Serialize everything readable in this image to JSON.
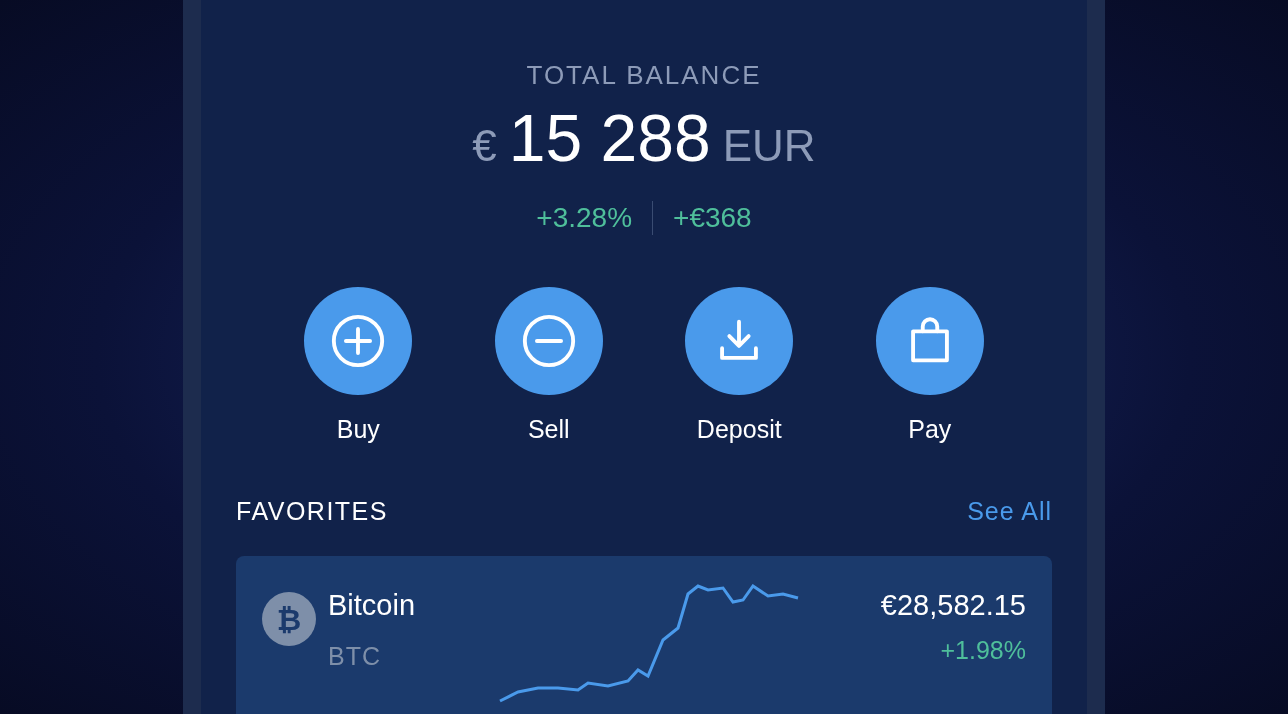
{
  "balance": {
    "label": "TOTAL BALANCE",
    "currency_symbol": "€",
    "amount": "15 288",
    "currency_code": "EUR",
    "change_percent": "+3.28%",
    "change_amount": "+€368"
  },
  "actions": [
    {
      "label": "Buy",
      "kind": "plus"
    },
    {
      "label": "Sell",
      "kind": "minus"
    },
    {
      "label": "Deposit",
      "kind": "download"
    },
    {
      "label": "Pay",
      "kind": "bag"
    }
  ],
  "favorites": {
    "title": "FAVORITES",
    "see_all": "See All",
    "items": [
      {
        "logo": "₿",
        "name": "Bitcoin",
        "symbol": "BTC",
        "price": "€28,582.15",
        "change": "+1.98%"
      }
    ]
  }
}
